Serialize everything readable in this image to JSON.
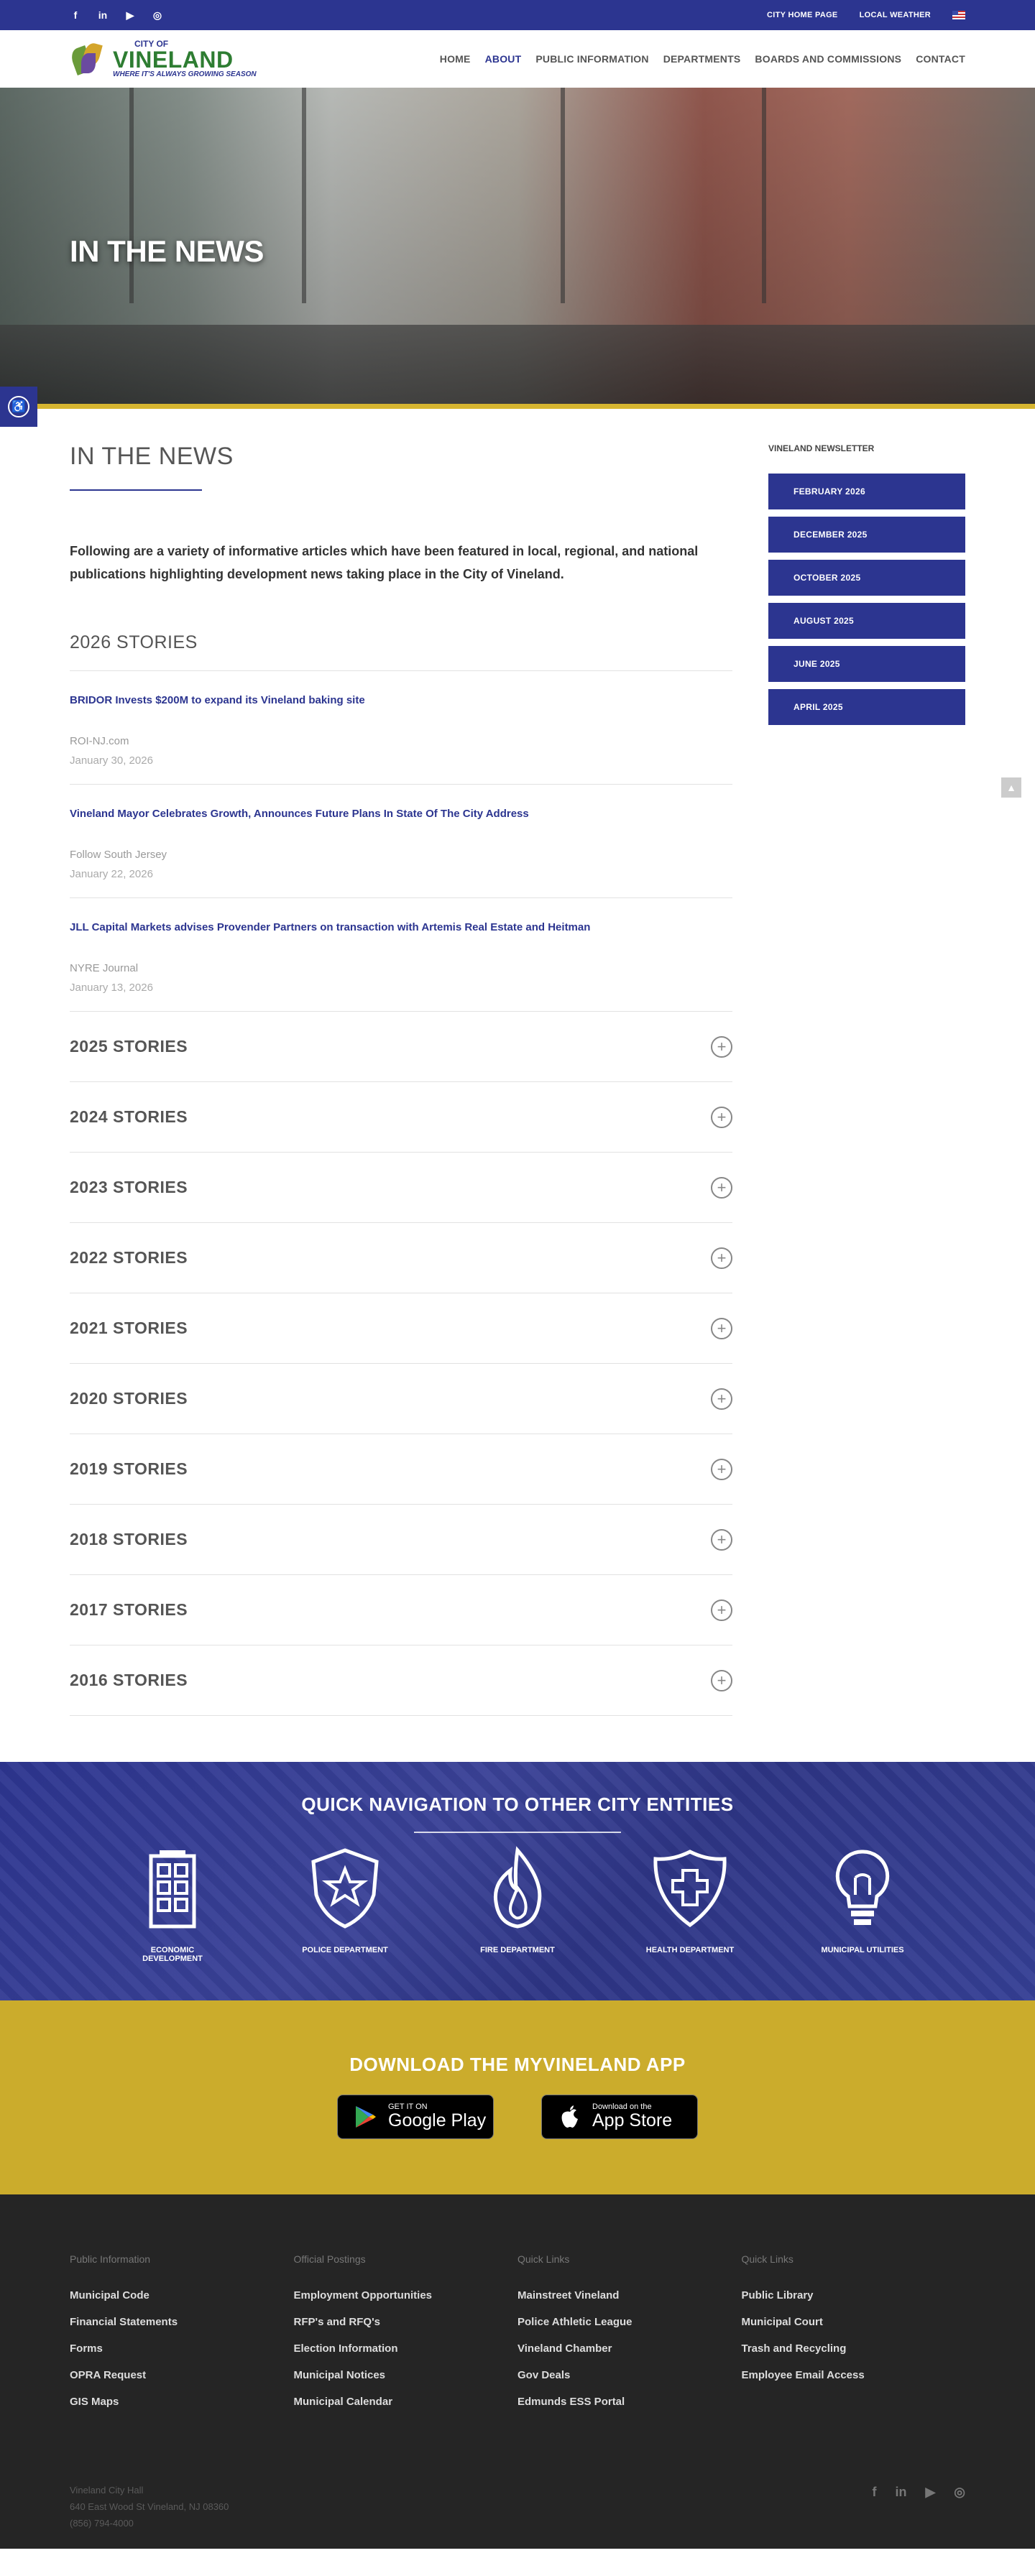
{
  "topbar": {
    "social": [
      {
        "icon": "facebook-icon",
        "glyph": "f"
      },
      {
        "icon": "linkedin-icon",
        "glyph": "in"
      },
      {
        "icon": "youtube-icon",
        "glyph": "▶"
      },
      {
        "icon": "instagram-icon",
        "glyph": "◎"
      }
    ],
    "links": [
      "CITY HOME PAGE",
      "LOCAL WEATHER"
    ]
  },
  "logo": {
    "small": "CITY OF",
    "big": "VINELAND",
    "tagline": "WHERE IT'S ALWAYS GROWING SEASON"
  },
  "nav": {
    "items": [
      "HOME",
      "ABOUT",
      "PUBLIC INFORMATION",
      "DEPARTMENTS",
      "BOARDS AND COMMISSIONS",
      "CONTACT"
    ],
    "active": "ABOUT"
  },
  "hero": {
    "title": "IN THE NEWS"
  },
  "main": {
    "title": "IN THE NEWS",
    "intro": "Following are a variety of informative articles which have been featured in local, regional, and national publications highlighting development news taking place in the City of Vineland.",
    "current_year": "2026 STORIES",
    "stories": [
      {
        "title": "BRIDOR Invests $200M to expand its Vineland baking site",
        "source": "ROI-NJ.com",
        "date": "January 30, 2026"
      },
      {
        "title": "Vineland Mayor Celebrates Growth, Announces Future Plans In State Of The City Address",
        "source": "Follow South Jersey",
        "date": "January 22, 2026"
      },
      {
        "title": "JLL Capital Markets advises Provender Partners on transaction with Artemis Real Estate and Heitman",
        "source": "NYRE Journal",
        "date": "January 13, 2026"
      }
    ],
    "years": [
      "2025 STORIES",
      "2024 STORIES",
      "2023 STORIES",
      "2022 STORIES",
      "2021 STORIES",
      "2020 STORIES",
      "2019 STORIES",
      "2018 STORIES",
      "2017 STORIES",
      "2016 STORIES"
    ]
  },
  "sidebar": {
    "title": "VINELAND NEWSLETTER",
    "items": [
      "FEBRUARY 2026",
      "DECEMBER 2025",
      "OCTOBER 2025",
      "AUGUST 2025",
      "JUNE 2025",
      "APRIL 2025"
    ]
  },
  "quicknav": {
    "title": "QUICK NAVIGATION TO OTHER CITY ENTITIES",
    "entities": [
      {
        "label": "ECONOMIC DEVELOPMENT",
        "icon": "building-icon"
      },
      {
        "label": "POLICE DEPARTMENT",
        "icon": "police-badge-icon"
      },
      {
        "label": "FIRE DEPARTMENT",
        "icon": "flame-icon"
      },
      {
        "label": "HEALTH DEPARTMENT",
        "icon": "health-shield-icon"
      },
      {
        "label": "MUNICIPAL UTILITIES",
        "icon": "lightbulb-icon"
      }
    ]
  },
  "app": {
    "title": "DOWNLOAD THE MYVINELAND APP",
    "google": {
      "small": "GET IT ON",
      "big": "Google Play"
    },
    "apple": {
      "small": "Download on the",
      "big": "App Store"
    }
  },
  "footer": {
    "columns": [
      {
        "head": "Public Information",
        "links": [
          "Municipal Code",
          "Financial Statements",
          "Forms",
          "OPRA Request",
          "GIS Maps"
        ]
      },
      {
        "head": "Official Postings",
        "links": [
          "Employment Opportunities",
          "RFP's and RFQ's",
          "Election Information",
          "Municipal Notices",
          "Municipal Calendar"
        ]
      },
      {
        "head": "Quick Links",
        "links": [
          "Mainstreet Vineland",
          "Police Athletic League",
          "Vineland Chamber",
          "Gov Deals",
          "Edmunds ESS Portal"
        ]
      },
      {
        "head": "Quick Links",
        "links": [
          "Public Library",
          "Municipal Court",
          "Trash and Recycling",
          "Employee Email Access"
        ]
      }
    ],
    "address": [
      "Vineland City Hall",
      "640 East Wood St Vineland, NJ 08360",
      "(856) 794-4000"
    ]
  },
  "colors": {
    "brand_blue": "#2c3590",
    "gold": "#cbac2c",
    "green": "#2e7d32",
    "footer_bg": "#252525"
  }
}
